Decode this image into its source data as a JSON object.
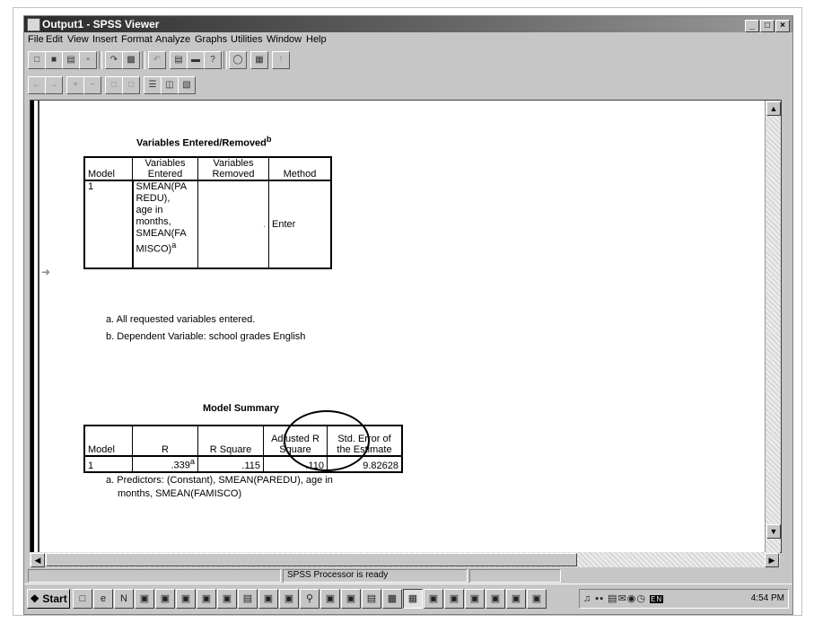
{
  "window": {
    "title": "Output1 - SPSS Viewer",
    "buttons": [
      "_",
      "□",
      "×"
    ]
  },
  "menu": [
    "File",
    "Edit",
    "View",
    "Insert",
    "Format",
    "Analyze",
    "Graphs",
    "Utilities",
    "Window",
    "Help"
  ],
  "toolbar1": [
    "open-icon",
    "save-icon",
    "print-icon",
    "print-preview-icon",
    "export-icon",
    "dialog-recall-icon",
    "undo-icon",
    "goto-chart-icon",
    "goto-case-icon",
    "variables-icon",
    "use-sets-icon",
    "show-all-icon",
    "designate-window-icon"
  ],
  "toolbar2": [
    "promote-icon",
    "demote-icon",
    "expand-icon",
    "collapse-icon",
    "show-icon",
    "hide-icon",
    "insert-heading-icon",
    "insert-title-icon",
    "insert-text-icon"
  ],
  "table1": {
    "title": "Variables Entered/Removed",
    "title_sup": "b",
    "headers": [
      "Model",
      "Variables Entered",
      "Variables Removed",
      "Method"
    ],
    "row": {
      "model": "1",
      "entered": [
        "SMEAN(PA",
        "REDU),",
        "age in",
        "months,",
        "SMEAN(FA",
        "MISCO)"
      ],
      "entered_sup": "a",
      "removed": ".",
      "method": "Enter"
    },
    "notes": [
      "a. All requested variables entered.",
      "b. Dependent Variable: school grades English"
    ]
  },
  "table2": {
    "title": "Model Summary",
    "headers": [
      "Model",
      "R",
      "R Square",
      "Adjusted R Square",
      "Std. Error of the Estimate"
    ],
    "row": {
      "model": "1",
      "r": ".339",
      "r_sup": "a",
      "r_square": ".115",
      "adj_r_square": ".110",
      "std_error": "9.82628"
    },
    "notes": [
      "a. Predictors: (Constant), SMEAN(PAREDU), age in",
      "months, SMEAN(FAMISCO)"
    ]
  },
  "status": "SPSS Processor  is ready",
  "taskbar": {
    "start": "Start",
    "time": "4:54 PM",
    "lang": "EN"
  }
}
